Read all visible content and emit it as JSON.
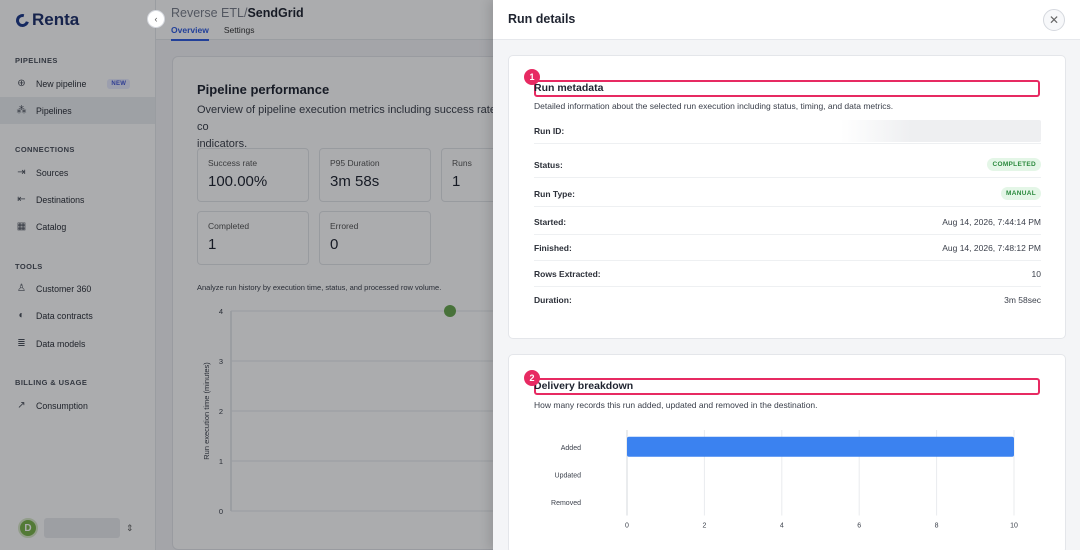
{
  "app": {
    "logo": "Renta"
  },
  "sidebar": {
    "sections": [
      {
        "title": "PIPELINES",
        "items": [
          {
            "label": "New pipeline",
            "icon": "plus-circle-icon",
            "badge": "NEW"
          },
          {
            "label": "Pipelines",
            "icon": "pipelines-icon",
            "active": true
          }
        ]
      },
      {
        "title": "CONNECTIONS",
        "items": [
          {
            "label": "Sources",
            "icon": "source-icon"
          },
          {
            "label": "Destinations",
            "icon": "destination-icon"
          },
          {
            "label": "Catalog",
            "icon": "catalog-icon"
          }
        ]
      },
      {
        "title": "TOOLS",
        "items": [
          {
            "label": "Customer 360",
            "icon": "user-icon"
          },
          {
            "label": "Data contracts",
            "icon": "shield-icon"
          },
          {
            "label": "Data models",
            "icon": "database-icon"
          }
        ]
      },
      {
        "title": "BILLING & USAGE",
        "items": [
          {
            "label": "Consumption",
            "icon": "chart-line-icon"
          }
        ]
      }
    ],
    "user": {
      "initial": "D"
    }
  },
  "header": {
    "breadcrumb_parent": "Reverse ETL",
    "breadcrumb_sep": "/",
    "breadcrumb_current": "SendGrid",
    "tabs": [
      {
        "label": "Overview",
        "active": true
      },
      {
        "label": "Settings"
      }
    ]
  },
  "performance": {
    "title": "Pipeline performance",
    "description": "Overview of pipeline execution metrics including success rate, co",
    "description_tail": "indicators.",
    "metrics": [
      {
        "label": "Success rate",
        "value": "100.00%"
      },
      {
        "label": "P95 Duration",
        "value": "3m 58s"
      },
      {
        "label": "Runs",
        "value": "1"
      },
      {
        "label": "Completed",
        "value": "1"
      },
      {
        "label": "Errored",
        "value": "0"
      }
    ],
    "chart_caption": "Analyze run history by execution time, status, and processed row volume.",
    "chart_data": {
      "type": "scatter",
      "ylabel": "Run execution time (minutes)",
      "yticks": [
        "4",
        "3",
        "2",
        "1",
        "0"
      ],
      "ylim": [
        0,
        4
      ],
      "series": [
        {
          "points": [
            {
              "y": 4
            }
          ]
        }
      ],
      "point_color": "#6aa84f"
    }
  },
  "panel": {
    "title": "Run details",
    "close_icon": "close-icon",
    "metadata": {
      "step": "1",
      "title": "Run metadata",
      "description": "Detailed information about the selected run execution including status, timing, and data metrics.",
      "rows": [
        {
          "label": "Run ID:",
          "value": "",
          "redacted": true
        },
        {
          "label": "Status:",
          "value": "COMPLETED",
          "pill": true
        },
        {
          "label": "Run Type:",
          "value": "MANUAL",
          "pill": true
        },
        {
          "label": "Started:",
          "value": "Aug 14, 2026, 7:44:14 PM"
        },
        {
          "label": "Finished:",
          "value": "Aug 14, 2026, 7:48:12 PM"
        },
        {
          "label": "Rows Extracted:",
          "value": "10"
        },
        {
          "label": "Duration:",
          "value": "3m 58sec"
        }
      ]
    },
    "delivery": {
      "step": "2",
      "title": "Delivery breakdown",
      "description": "How many records this run added, updated and removed in the destination.",
      "chart_data": {
        "type": "bar",
        "orientation": "horizontal",
        "categories": [
          "Added",
          "Updated",
          "Removed"
        ],
        "values": [
          10,
          0,
          0
        ],
        "xticks": [
          "0",
          "2",
          "4",
          "6",
          "8",
          "10"
        ],
        "xlim": [
          0,
          10
        ],
        "bar_color": "#3b82f0"
      }
    }
  }
}
